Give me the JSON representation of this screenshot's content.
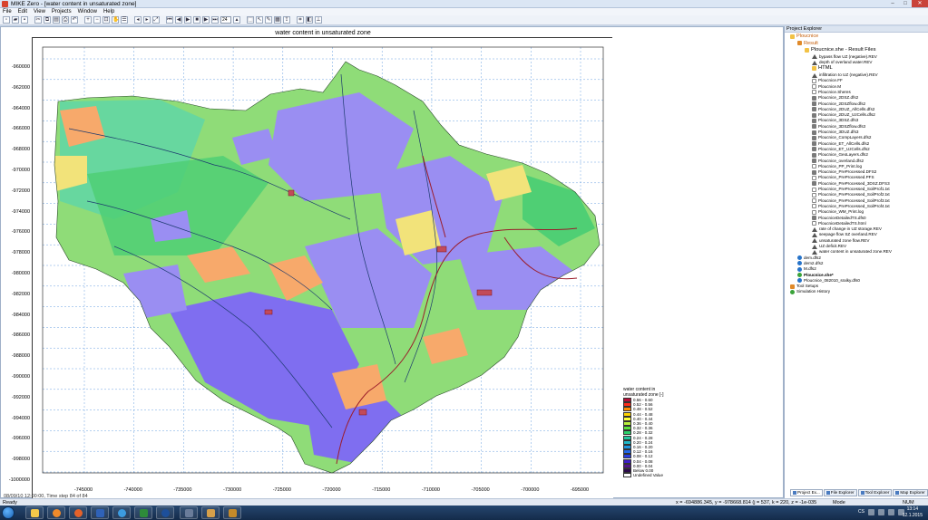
{
  "window": {
    "title": "MIKE Zero - [water content in unsaturated zone]",
    "min": "–",
    "max": "□",
    "close": "✕"
  },
  "menu": [
    "File",
    "Edit",
    "View",
    "Projects",
    "Window",
    "Help"
  ],
  "toolbar": {
    "buttons": [
      "new",
      "open",
      "save",
      "cut",
      "copy",
      "paste",
      "print",
      "undo",
      "zoom-in",
      "zoom-out",
      "zoom-box",
      "pan",
      "properties",
      "animation-first",
      "animation-prev",
      "animation-play",
      "animation-stop",
      "animation-next",
      "animation-last",
      "frame-step",
      "select",
      "pointer",
      "draw",
      "table",
      "export",
      "measure"
    ],
    "frame_step_value": "24"
  },
  "plot": {
    "title": "water content in unsaturated zone",
    "y_ticks": [
      "-960000",
      "-962000",
      "-964000",
      "-966000",
      "-968000",
      "-970000",
      "-972000",
      "-974000",
      "-976000",
      "-978000",
      "-980000",
      "-982000",
      "-984000",
      "-986000",
      "-988000",
      "-990000",
      "-992000",
      "-994000",
      "-996000",
      "-998000",
      "-1000000"
    ],
    "x_ticks": [
      "-745000",
      "-740000",
      "-735000",
      "-730000",
      "-725000",
      "-720000",
      "-715000",
      "-710000",
      "-705000",
      "-700000",
      "-695000"
    ],
    "timestamp": "08/09/10 12:00:00, Time step 84 of 84"
  },
  "legend": {
    "title_line1": "water content in",
    "title_line2": "unsaturated zone [-]",
    "items": [
      {
        "label": "0.56 - 0.60",
        "color": "#b5103a"
      },
      {
        "label": "0.52 - 0.56",
        "color": "#ff2d1a"
      },
      {
        "label": "0.48 - 0.52",
        "color": "#ff8a00"
      },
      {
        "label": "0.44 - 0.48",
        "color": "#ffd200"
      },
      {
        "label": "0.40 - 0.44",
        "color": "#ffff3c"
      },
      {
        "label": "0.36 - 0.40",
        "color": "#b8f03a"
      },
      {
        "label": "0.32 - 0.36",
        "color": "#5ce43a"
      },
      {
        "label": "0.28 - 0.32",
        "color": "#2bd06a"
      },
      {
        "label": "0.24 - 0.28",
        "color": "#24c8a0"
      },
      {
        "label": "0.20 - 0.24",
        "color": "#20b8c8"
      },
      {
        "label": "0.16 - 0.20",
        "color": "#1e96e0"
      },
      {
        "label": "0.12 - 0.16",
        "color": "#2268e8"
      },
      {
        "label": "0.08 - 0.12",
        "color": "#2a3ee0"
      },
      {
        "label": "0.04 - 0.08",
        "color": "#3c1ec8"
      },
      {
        "label": "0.00 - 0.04",
        "color": "#50148c"
      },
      {
        "label": "Below 0.00",
        "color": "#2b0a4a"
      },
      {
        "label": "Undefined Value",
        "color": "#ffffff"
      }
    ]
  },
  "map_colors": {
    "lightgreen": "#8fdc78",
    "midgreen": "#4fcf74",
    "teal": "#63d6a3",
    "purple": "#9a8ef2",
    "violet": "#7f6ef0",
    "orange": "#f7a96b",
    "yellow": "#f2e37a",
    "river": "#1c3a6e",
    "redriver": "#9b1c2a"
  },
  "explorer": {
    "header": "Project Explorer",
    "items": [
      {
        "label": "Ploucnice",
        "icon": "folder",
        "indent": 0,
        "style": "orange"
      },
      {
        "label": "Result",
        "icon": "result",
        "indent": 1,
        "style": "orange"
      },
      {
        "label": "Ploucnice.she - Result Files",
        "icon": "folder",
        "indent": 2,
        "style": "big"
      },
      {
        "label": "bypass flow UZ (negative).REV",
        "icon": "tri",
        "indent": 3
      },
      {
        "label": "depth of overland water.REV",
        "icon": "tri",
        "indent": 3
      },
      {
        "label": "HTML",
        "icon": "folder",
        "indent": 3,
        "style": "big"
      },
      {
        "label": "infiltration to UZ (negative).REV",
        "icon": "tri",
        "indent": 3
      },
      {
        "label": "Ploucnice.FF",
        "icon": "file",
        "indent": 3
      },
      {
        "label": "Ploucnice.M",
        "icon": "file",
        "indent": 3
      },
      {
        "label": "Ploucnice.Sheres",
        "icon": "file",
        "indent": 3
      },
      {
        "label": "Ploucnice_2DSZ.dfs2",
        "icon": "doc",
        "indent": 3
      },
      {
        "label": "Ploucnice_2DSZflow.dfs2",
        "icon": "doc",
        "indent": 3
      },
      {
        "label": "Ploucnice_2DUZ_AllCells.dfs2",
        "icon": "doc",
        "indent": 3
      },
      {
        "label": "Ploucnice_2DUZ_UzCells.dfs2",
        "icon": "doc",
        "indent": 3
      },
      {
        "label": "Ploucnice_3DSZ.dfs3",
        "icon": "doc",
        "indent": 3
      },
      {
        "label": "Ploucnice_3DSZflow.dfs3",
        "icon": "doc",
        "indent": 3
      },
      {
        "label": "Ploucnice_3DUZ.dfs3",
        "icon": "doc",
        "indent": 3
      },
      {
        "label": "Ploucnice_CompLayers.dfs2",
        "icon": "doc",
        "indent": 3
      },
      {
        "label": "Ploucnice_ET_AllCells.dfs2",
        "icon": "doc",
        "indent": 3
      },
      {
        "label": "Ploucnice_ET_UzCells.dfs2",
        "icon": "doc",
        "indent": 3
      },
      {
        "label": "Ploucnice_GeoLayers.dfs2",
        "icon": "doc",
        "indent": 3
      },
      {
        "label": "Ploucnice_overland.dfs2",
        "icon": "doc",
        "indent": 3
      },
      {
        "label": "Ploucnice_PP_Print.log",
        "icon": "file",
        "indent": 3
      },
      {
        "label": "Ploucnice_PreProcessed.DFS2",
        "icon": "doc",
        "indent": 3
      },
      {
        "label": "Ploucnice_PreProcessed.PFS",
        "icon": "file",
        "indent": 3
      },
      {
        "label": "Ploucnice_PreProcessed_3DSZ.DFS3",
        "icon": "doc",
        "indent": 3
      },
      {
        "label": "Ploucnice_PreProcessed_SoilProf1.txt",
        "icon": "file",
        "indent": 3
      },
      {
        "label": "Ploucnice_PreProcessed_SoilProf2.txt",
        "icon": "file",
        "indent": 3
      },
      {
        "label": "Ploucnice_PreProcessed_SoilProf3.txt",
        "icon": "file",
        "indent": 3
      },
      {
        "label": "Ploucnice_PreProcessed_SoilProf4.txt",
        "icon": "file",
        "indent": 3
      },
      {
        "label": "Ploucnice_WM_Print.log",
        "icon": "file",
        "indent": 3
      },
      {
        "label": "PloucniceDetailedTS.dfs0",
        "icon": "doc",
        "indent": 3
      },
      {
        "label": "PloucniceDetailedTS.html",
        "icon": "file",
        "indent": 3
      },
      {
        "label": "rate of change in UZ storage.REV",
        "icon": "tri",
        "indent": 3
      },
      {
        "label": "seepage flow SZ overland.REV",
        "icon": "tri",
        "indent": 3
      },
      {
        "label": "unsaturated zone flow.REV",
        "icon": "tri",
        "indent": 3
      },
      {
        "label": "UZ deficit.REV",
        "icon": "tri",
        "indent": 3
      },
      {
        "label": "water content in unsaturated zone.REV",
        "icon": "tri",
        "indent": 3
      },
      {
        "label": "dem.dfs2",
        "icon": "blue",
        "indent": 1
      },
      {
        "label": "dem2.dfs2",
        "icon": "blue",
        "indent": 1
      },
      {
        "label": "M.dfs2",
        "icon": "blue",
        "indent": 1
      },
      {
        "label": "Ploucnice.she*",
        "icon": "green",
        "indent": 1,
        "style": "bold"
      },
      {
        "label": "Ploucnice_082010_sralky.dfs0",
        "icon": "blue",
        "indent": 1
      },
      {
        "label": "Tool Setups",
        "icon": "result",
        "indent": 0
      },
      {
        "label": "Simulation History",
        "icon": "green",
        "indent": 0
      }
    ],
    "tabs": [
      "Project Ex...",
      "File Explorer",
      "Tool Explorer",
      "Map Explorer"
    ]
  },
  "status": {
    "ready": "Ready",
    "coords": "x = -694886.345, y = -978668.814 (j = 537, k = 220, z = -1e-035",
    "mode": "Mode",
    "num": "NUM"
  },
  "taskbar": {
    "items": [
      "explorer",
      "media",
      "firefox",
      "word",
      "ie",
      "excel",
      "mike",
      "vmware",
      "paint",
      "dragon"
    ],
    "lang": "CS",
    "time": "13:14",
    "date": "12.1.2015"
  }
}
